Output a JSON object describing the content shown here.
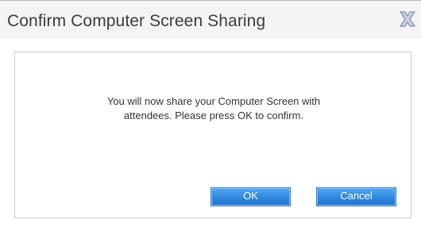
{
  "dialog": {
    "title": "Confirm Computer Screen Sharing",
    "close_icon": "close-x-icon",
    "message_line1": "You will now share your Computer Screen with",
    "message_line2": "attendees. Please press OK to confirm.",
    "ok_label": "OK",
    "cancel_label": "Cancel"
  },
  "colors": {
    "button_blue": "#2f86dc",
    "title_bar": "#f4f4f4",
    "close_icon": "#9aa9c8"
  }
}
